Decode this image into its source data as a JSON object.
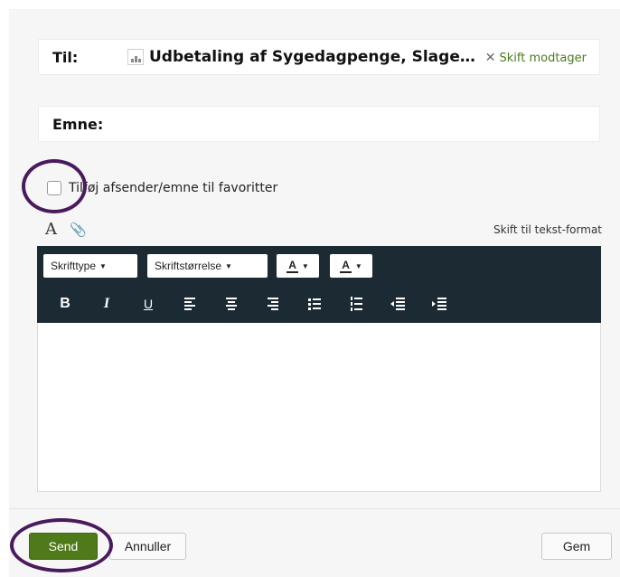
{
  "to": {
    "label": "Til:",
    "recipient": "Udbetaling af Sygedagpenge, Slage…",
    "change_link": "Skift modtager"
  },
  "subject": {
    "label": "Emne:",
    "value": ""
  },
  "favorites": {
    "label": "Tilføj afsender/emne til favoritter",
    "checked": false
  },
  "editor": {
    "text_format_link": "Skift til tekst-format",
    "font_dropdown": "Skrifttype",
    "size_dropdown": "Skriftstørrelse",
    "font_color_label": "A",
    "bg_color_label": "A",
    "bold_label": "B",
    "italic_label": "I",
    "underline_label": "U",
    "body": ""
  },
  "actions": {
    "send": "Send",
    "cancel": "Annuller",
    "save": "Gem"
  },
  "colors": {
    "toolbar": "#1b2a33",
    "send_button": "#4f7a1a",
    "link": "#4a7a1e",
    "highlight_ring": "#4a1a5e"
  }
}
